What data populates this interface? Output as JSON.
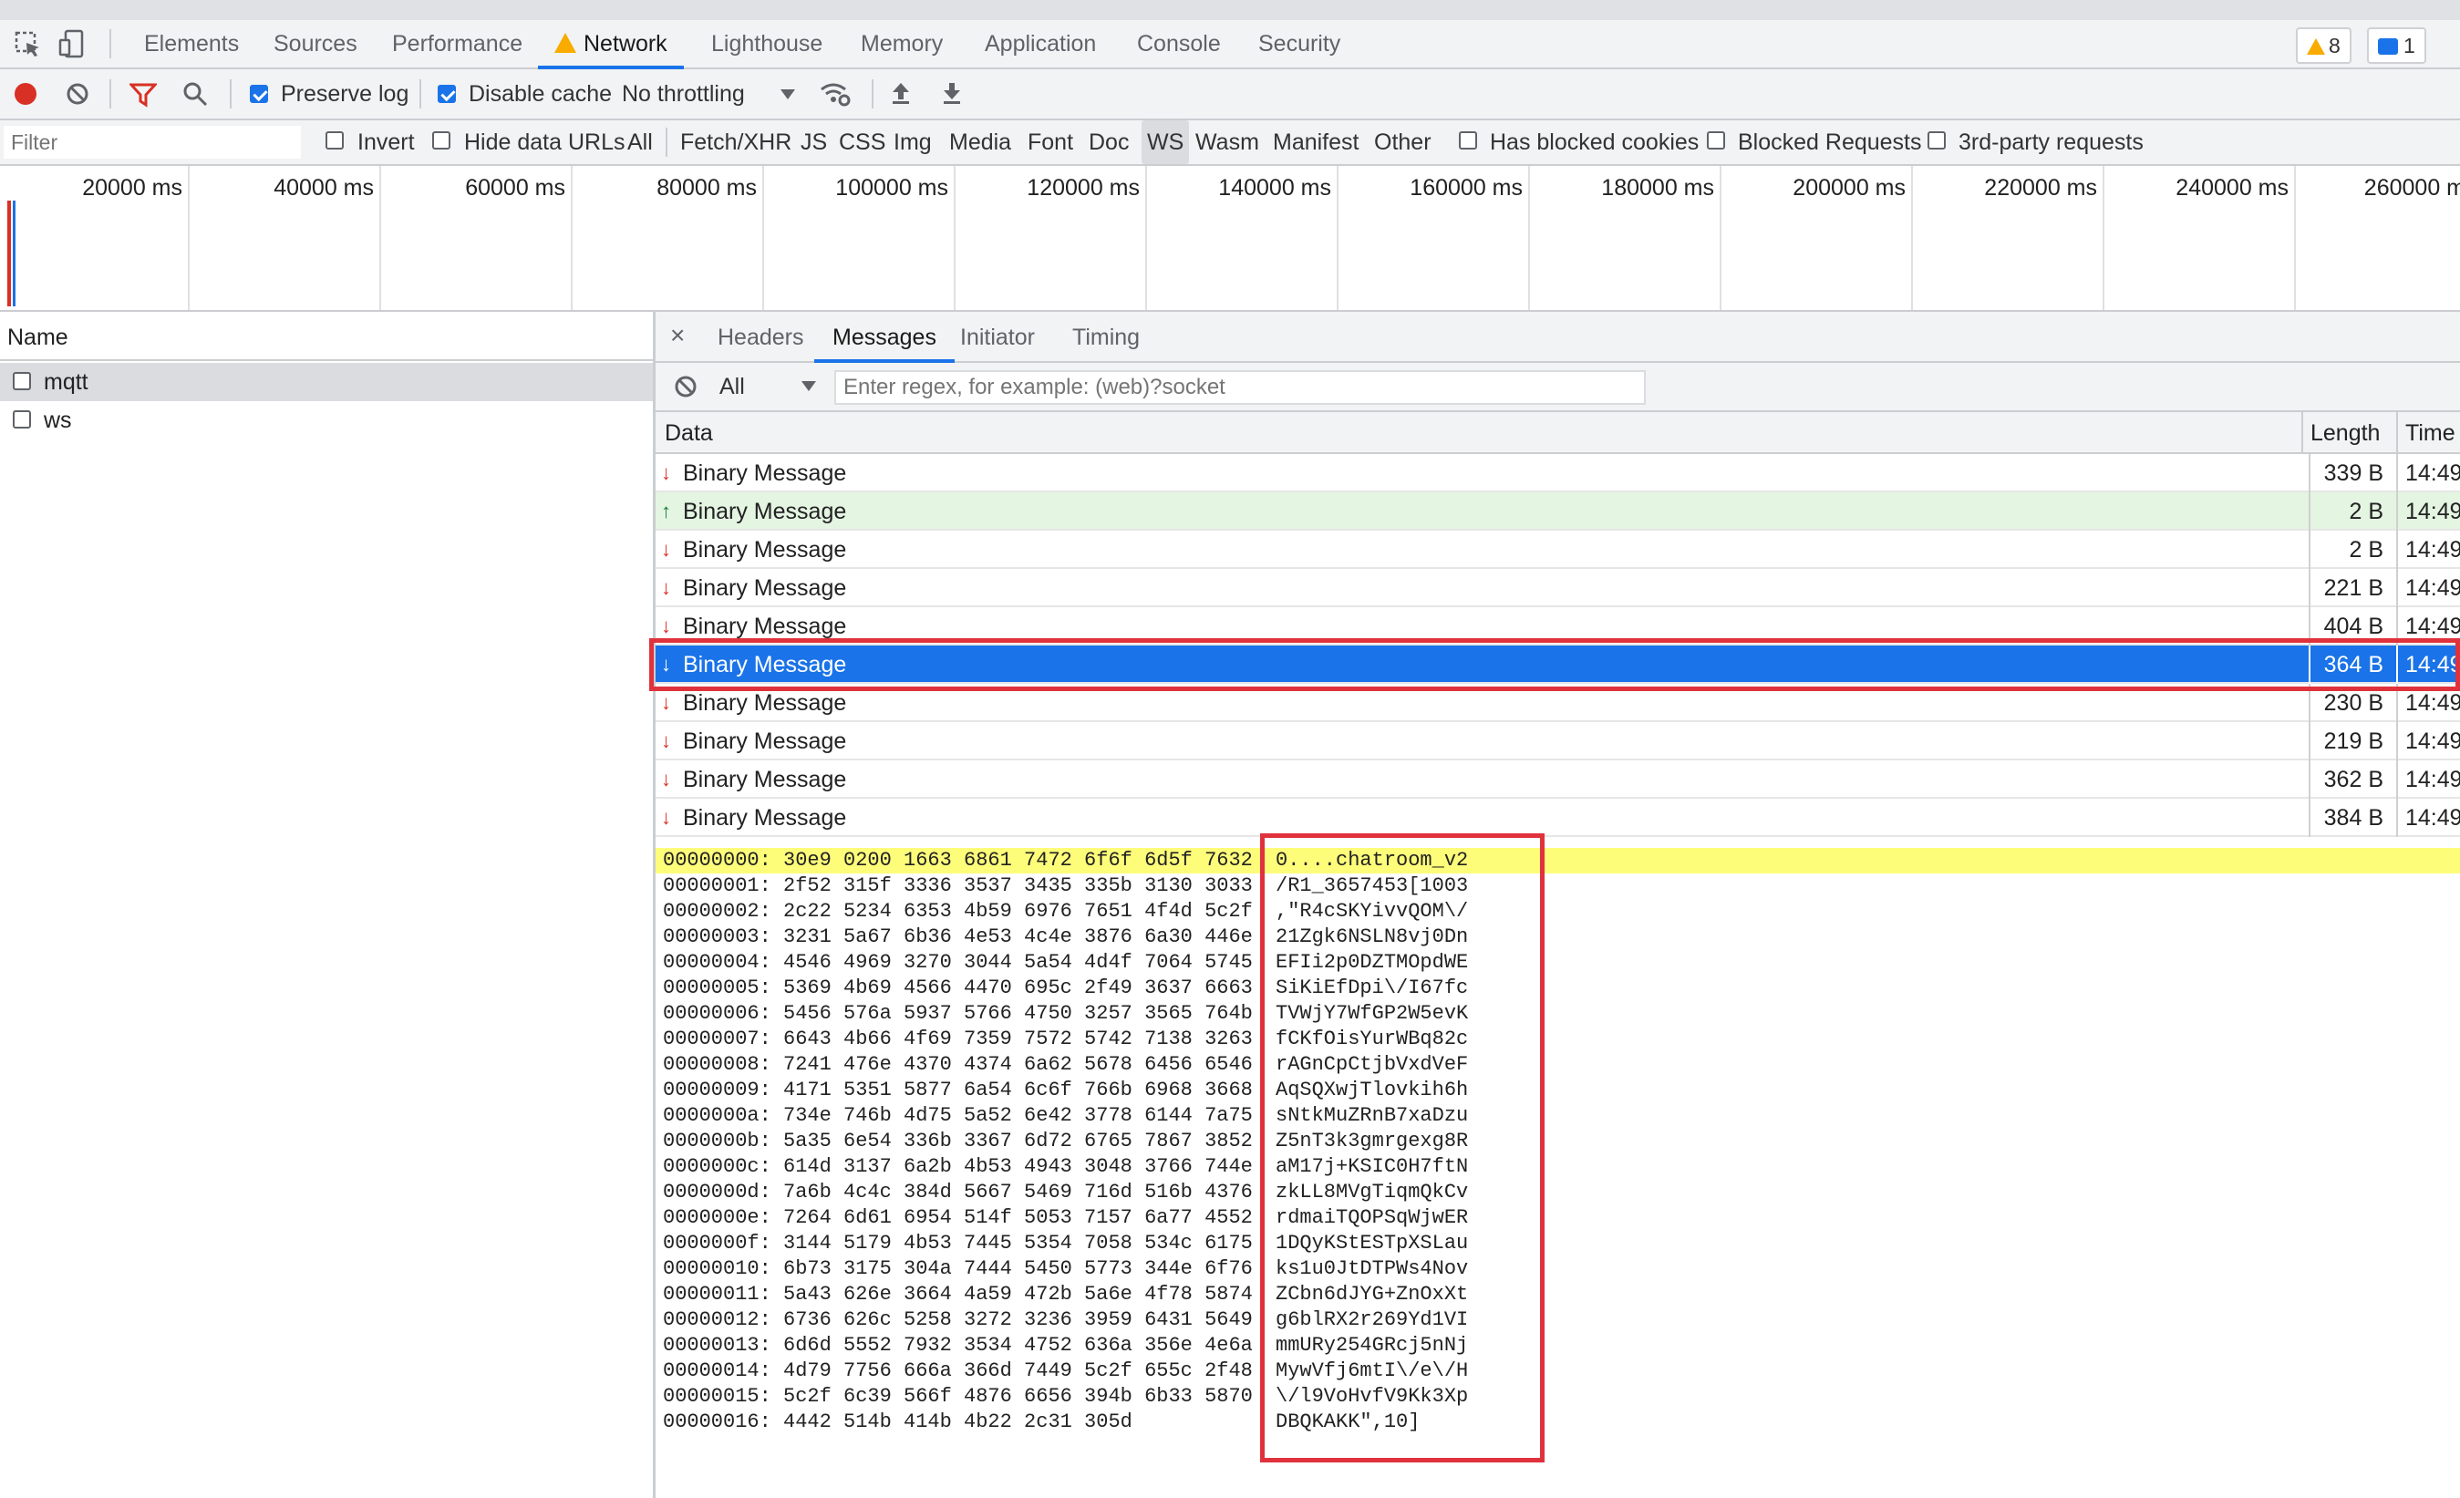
{
  "tabs": [
    "Elements",
    "Sources",
    "Performance",
    "Network",
    "Lighthouse",
    "Memory",
    "Application",
    "Console",
    "Security"
  ],
  "active_tab": "Network",
  "badges": {
    "warnings": "8",
    "messages": "1"
  },
  "toolbar": {
    "preserve_log": "Preserve log",
    "disable_cache": "Disable cache",
    "throttling": "No throttling"
  },
  "filter": {
    "placeholder": "Filter",
    "invert": "Invert",
    "hide_data_urls": "Hide data URLs",
    "types": [
      "All",
      "Fetch/XHR",
      "JS",
      "CSS",
      "Img",
      "Media",
      "Font",
      "Doc",
      "WS",
      "Wasm",
      "Manifest",
      "Other"
    ],
    "selected_type": "WS",
    "has_blocked_cookies": "Has blocked cookies",
    "blocked_requests": "Blocked Requests",
    "third_party": "3rd-party requests"
  },
  "timeline": {
    "ticks": [
      "20000 ms",
      "40000 ms",
      "60000 ms",
      "80000 ms",
      "100000 ms",
      "120000 ms",
      "140000 ms",
      "160000 ms",
      "180000 ms",
      "200000 ms",
      "220000 ms",
      "240000 ms",
      "260000 m"
    ]
  },
  "requests": {
    "header": "Name",
    "items": [
      "mqtt",
      "ws"
    ]
  },
  "detail": {
    "tabs": [
      "Headers",
      "Messages",
      "Initiator",
      "Timing"
    ],
    "active_tab": "Messages",
    "message_filter": "All",
    "regex_placeholder": "Enter regex, for example: (web)?socket",
    "columns": {
      "data": "Data",
      "length": "Length",
      "time": "Time"
    },
    "messages": [
      {
        "dir": "down",
        "data": "Binary Message",
        "length": "339 B",
        "time": "14:49:"
      },
      {
        "dir": "up",
        "data": "Binary Message",
        "length": "2 B",
        "time": "14:49:"
      },
      {
        "dir": "down",
        "data": "Binary Message",
        "length": "2 B",
        "time": "14:49:"
      },
      {
        "dir": "down",
        "data": "Binary Message",
        "length": "221 B",
        "time": "14:49:"
      },
      {
        "dir": "down",
        "data": "Binary Message",
        "length": "404 B",
        "time": "14:49:"
      },
      {
        "dir": "down",
        "data": "Binary Message",
        "length": "364 B",
        "time": "14:49"
      },
      {
        "dir": "down",
        "data": "Binary Message",
        "length": "230 B",
        "time": "14:49:"
      },
      {
        "dir": "down",
        "data": "Binary Message",
        "length": "219 B",
        "time": "14:49:"
      },
      {
        "dir": "down",
        "data": "Binary Message",
        "length": "362 B",
        "time": "14:49:"
      },
      {
        "dir": "down",
        "data": "Binary Message",
        "length": "384 B",
        "time": "14:49:"
      }
    ],
    "selected_index": 5
  },
  "hexdump": [
    {
      "off": "00000000:",
      "hex": "30e9 0200 1663 6861 7472 6f6f 6d5f 7632",
      "ascii": "0....chatroom_v2"
    },
    {
      "off": "00000001:",
      "hex": "2f52 315f 3336 3537 3435 335b 3130 3033",
      "ascii": "/R1_3657453[1003"
    },
    {
      "off": "00000002:",
      "hex": "2c22 5234 6353 4b59 6976 7651 4f4d 5c2f",
      "ascii": ",\"R4cSKYivvQOM\\/"
    },
    {
      "off": "00000003:",
      "hex": "3231 5a67 6b36 4e53 4c4e 3876 6a30 446e",
      "ascii": "21Zgk6NSLN8vj0Dn"
    },
    {
      "off": "00000004:",
      "hex": "4546 4969 3270 3044 5a54 4d4f 7064 5745",
      "ascii": "EFIi2p0DZTMOpdWE"
    },
    {
      "off": "00000005:",
      "hex": "5369 4b69 4566 4470 695c 2f49 3637 6663",
      "ascii": "SiKiEfDpi\\/I67fc"
    },
    {
      "off": "00000006:",
      "hex": "5456 576a 5937 5766 4750 3257 3565 764b",
      "ascii": "TVWjY7WfGP2W5evK"
    },
    {
      "off": "00000007:",
      "hex": "6643 4b66 4f69 7359 7572 5742 7138 3263",
      "ascii": "fCKfOisYurWBq82c"
    },
    {
      "off": "00000008:",
      "hex": "7241 476e 4370 4374 6a62 5678 6456 6546",
      "ascii": "rAGnCpCtjbVxdVeF"
    },
    {
      "off": "00000009:",
      "hex": "4171 5351 5877 6a54 6c6f 766b 6968 3668",
      "ascii": "AqSQXwjTlovkih6h"
    },
    {
      "off": "0000000a:",
      "hex": "734e 746b 4d75 5a52 6e42 3778 6144 7a75",
      "ascii": "sNtkMuZRnB7xaDzu"
    },
    {
      "off": "0000000b:",
      "hex": "5a35 6e54 336b 3367 6d72 6765 7867 3852",
      "ascii": "Z5nT3k3gmrgexg8R"
    },
    {
      "off": "0000000c:",
      "hex": "614d 3137 6a2b 4b53 4943 3048 3766 744e",
      "ascii": "aM17j+KSIC0H7ftN"
    },
    {
      "off": "0000000d:",
      "hex": "7a6b 4c4c 384d 5667 5469 716d 516b 4376",
      "ascii": "zkLL8MVgTiqmQkCv"
    },
    {
      "off": "0000000e:",
      "hex": "7264 6d61 6954 514f 5053 7157 6a77 4552",
      "ascii": "rdmaiTQOPSqWjwER"
    },
    {
      "off": "0000000f:",
      "hex": "3144 5179 4b53 7445 5354 7058 534c 6175",
      "ascii": "1DQyKStESTpXSLau"
    },
    {
      "off": "00000010:",
      "hex": "6b73 3175 304a 7444 5450 5773 344e 6f76",
      "ascii": "ks1u0JtDTPWs4Nov"
    },
    {
      "off": "00000011:",
      "hex": "5a43 626e 3664 4a59 472b 5a6e 4f78 5874",
      "ascii": "ZCbn6dJYG+ZnOxXt"
    },
    {
      "off": "00000012:",
      "hex": "6736 626c 5258 3272 3236 3959 6431 5649",
      "ascii": "g6blRX2r269Yd1VI"
    },
    {
      "off": "00000013:",
      "hex": "6d6d 5552 7932 3534 4752 636a 356e 4e6a",
      "ascii": "mmURy254GRcj5nNj"
    },
    {
      "off": "00000014:",
      "hex": "4d79 7756 666a 366d 7449 5c2f 655c 2f48",
      "ascii": "MywVfj6mtI\\/e\\/H"
    },
    {
      "off": "00000015:",
      "hex": "5c2f 6c39 566f 4876 6656 394b 6b33 5870",
      "ascii": "\\/l9VoHvfV9Kk3Xp"
    },
    {
      "off": "00000016:",
      "hex": "4442 514b 414b 4b22 2c31 305d",
      "ascii": "DBQKAKK\",10]"
    }
  ],
  "colors": {
    "accent": "#1a73e8",
    "highlight_box": "#e0323c",
    "first_hex_line": "#fefd7a",
    "sent_row": "#e4f5e2"
  }
}
